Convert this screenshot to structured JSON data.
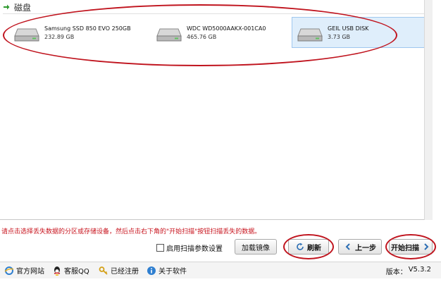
{
  "section": {
    "title": "磁盘"
  },
  "disks": [
    {
      "name": "Samsung SSD 850 EVO 250GB",
      "size": "232.89 GB",
      "selected": false
    },
    {
      "name": "WDC WD5000AAKX-001CA0",
      "size": "465.76 GB",
      "selected": false
    },
    {
      "name": "GEIL USB DISK",
      "size": "3.73 GB",
      "selected": true
    }
  ],
  "hint": "请点击选择丢失数据的分区或存储设备，然后点击右下角的\"开始扫描\"按钮扫描丢失的数据。",
  "actions": {
    "scan_settings_label": "启用扫描参数设置",
    "load_image_label": "加载镜像",
    "refresh_label": "刷新",
    "back_label": "上一步",
    "start_scan_label": "开始扫描"
  },
  "statusbar": {
    "website_label": "官方网站",
    "qq_label": "客服QQ",
    "registered_label": "已经注册",
    "about_label": "关于软件",
    "version_label": "版本：",
    "version_value": "V5.3.2"
  },
  "colors": {
    "accent_red": "#c0141e",
    "selection": "#dfeefb",
    "hint_red": "#c8141e"
  }
}
